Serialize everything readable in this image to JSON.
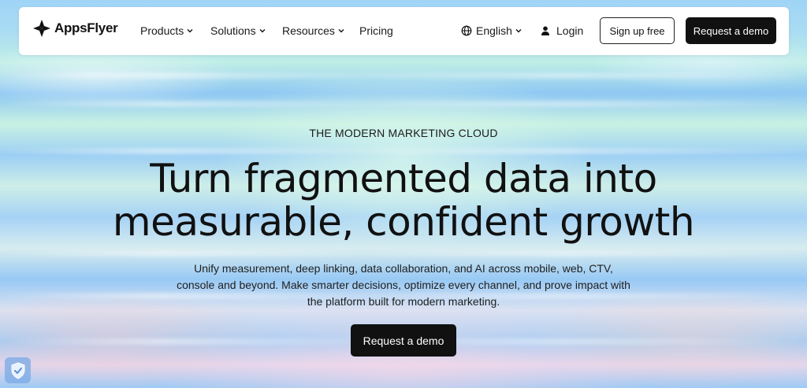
{
  "brand": {
    "name": "AppsFlyer"
  },
  "nav": {
    "items": [
      {
        "label": "Products",
        "has_dropdown": true
      },
      {
        "label": "Solutions",
        "has_dropdown": true
      },
      {
        "label": "Resources",
        "has_dropdown": true
      },
      {
        "label": "Pricing",
        "has_dropdown": false
      }
    ],
    "language": "English",
    "login": "Login",
    "signup": "Sign up free",
    "demo": "Request a demo"
  },
  "hero": {
    "eyebrow": "THE MODERN MARKETING CLOUD",
    "headline_line1": "Turn fragmented data into",
    "headline_line2": "measurable, confident growth",
    "subtext_line1": "Unify measurement, deep linking, data collaboration, and AI across mobile, web, CTV,",
    "subtext_line2": "console and beyond. Make smarter decisions, optimize every channel, and prove impact with",
    "subtext_line3": "the platform built for modern marketing.",
    "cta": "Request a demo"
  },
  "icons": {
    "logo": "appsflyer-logo-icon",
    "globe": "globe-icon",
    "user": "user-icon",
    "chevron": "chevron-down-icon",
    "shield": "shield-check-icon"
  },
  "colors": {
    "primary_button": "#111111",
    "background_blue": "#9fd4f6",
    "background_mint": "#c8f1e3"
  }
}
